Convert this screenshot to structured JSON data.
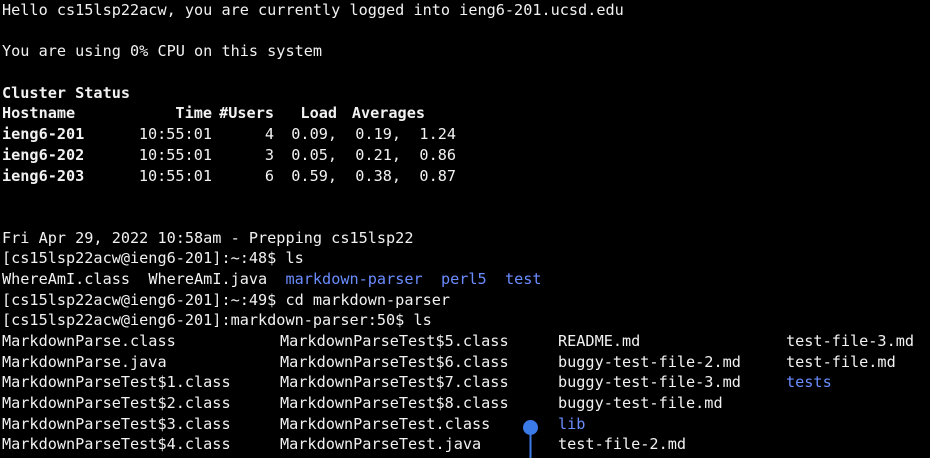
{
  "motd": {
    "hello": "Hello cs15lsp22acw, you are currently logged into ieng6-201.ucsd.edu",
    "cpu": "You are using 0% CPU on this system"
  },
  "cluster": {
    "title": "Cluster Status",
    "headers": [
      "Hostname",
      "Time",
      "#Users",
      "Load",
      "Averages"
    ],
    "rows": [
      {
        "host": "ieng6-201",
        "time": "10:55:01",
        "users": "4",
        "l1": "0.09,",
        "l2": "0.19,",
        "l3": "1.24"
      },
      {
        "host": "ieng6-202",
        "time": "10:55:01",
        "users": "3",
        "l1": "0.05,",
        "l2": "0.21,",
        "l3": "0.86"
      },
      {
        "host": "ieng6-203",
        "time": "10:55:01",
        "users": "6",
        "l1": "0.59,",
        "l2": "0.38,",
        "l3": "0.87"
      }
    ]
  },
  "session": {
    "prep": "Fri Apr 29, 2022 10:58am - Prepping cs15lsp22",
    "prompt1": "[cs15lsp22acw@ieng6-201]:~:48$ ls",
    "ls1_files": [
      "WhereAmI.class",
      "WhereAmI.java"
    ],
    "ls1_dirs": [
      "markdown-parser",
      "perl5",
      "test"
    ],
    "prompt2": "[cs15lsp22acw@ieng6-201]:~:49$ cd markdown-parser",
    "prompt3": "[cs15lsp22acw@ieng6-201]:markdown-parser:50$ ls"
  },
  "ls2": {
    "rows": [
      [
        {
          "t": "MarkdownParse.class"
        },
        {
          "t": "MarkdownParseTest$5.class"
        },
        {
          "t": "README.md"
        },
        {
          "t": "test-file-3.md"
        }
      ],
      [
        {
          "t": "MarkdownParse.java"
        },
        {
          "t": "MarkdownParseTest$6.class"
        },
        {
          "t": "buggy-test-file-2.md"
        },
        {
          "t": "test-file.md"
        }
      ],
      [
        {
          "t": "MarkdownParseTest$1.class"
        },
        {
          "t": "MarkdownParseTest$7.class"
        },
        {
          "t": "buggy-test-file-3.md"
        },
        {
          "t": "tests",
          "dir": true
        }
      ],
      [
        {
          "t": "MarkdownParseTest$2.class"
        },
        {
          "t": "MarkdownParseTest$8.class"
        },
        {
          "t": "buggy-test-file.md"
        },
        {
          "t": ""
        }
      ],
      [
        {
          "t": "MarkdownParseTest$3.class"
        },
        {
          "t": "MarkdownParseTest.class"
        },
        {
          "t": "lib",
          "dir": true
        },
        {
          "t": ""
        }
      ],
      [
        {
          "t": "MarkdownParseTest$4.class"
        },
        {
          "t": "MarkdownParseTest.java"
        },
        {
          "t": "test-file-2.md"
        },
        {
          "t": ""
        }
      ]
    ]
  },
  "colors": {
    "background": "#000000",
    "text": "#f2f2f2",
    "directory": "#6b8cff",
    "marker": "#3b7be8"
  }
}
